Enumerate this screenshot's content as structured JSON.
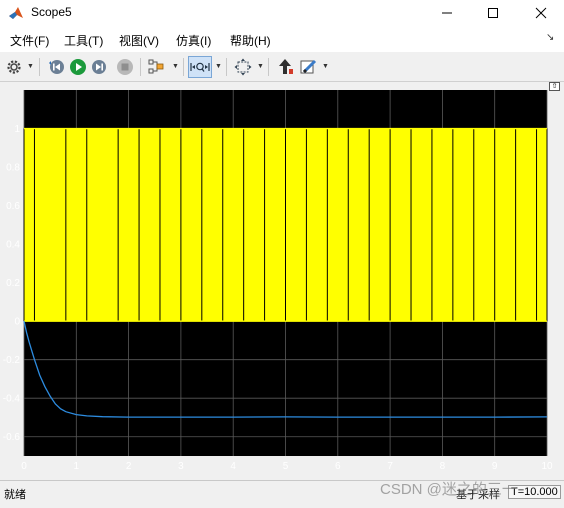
{
  "window": {
    "title": "Scope5"
  },
  "menu": {
    "items": [
      "文件(F)",
      "工具(T)",
      "视图(V)",
      "仿真(I)",
      "帮助(H)"
    ]
  },
  "toolbar": {
    "icons": [
      "gear-icon",
      "step-back-icon",
      "run-icon",
      "stop-icon",
      "triggers-icon",
      "zoom-x-icon",
      "autoscale-icon",
      "write-icon",
      "highlight-icon"
    ]
  },
  "status": {
    "left": "就绪",
    "middle": "基于采样",
    "time": "T=10.000"
  },
  "watermark": "CSDN @迷之的三一",
  "colors": {
    "plot_background": "#000000",
    "signal_1": "#ffff00",
    "signal_2": "#2d8ce0",
    "grid": "#5a5a5a",
    "axis_text": "#ffffff"
  },
  "chart_data": {
    "type": "line",
    "xlim": [
      0,
      10
    ],
    "ylim": [
      -0.7,
      1.2
    ],
    "xticks": [
      "0",
      "1",
      "2",
      "3",
      "4",
      "5",
      "6",
      "7",
      "8",
      "9",
      "10"
    ],
    "yticks": [
      "1",
      "0.8",
      "0.6",
      "0.4",
      "0.2",
      "0",
      "-0.2",
      "-0.4",
      "-0.6"
    ],
    "grid": true,
    "series": [
      {
        "color": "#ffff00",
        "kind": "square-wave",
        "low": 0,
        "high": 1,
        "edges": [
          0.0,
          0.2,
          0.8,
          1.2,
          1.8,
          2.2,
          2.6,
          3.0,
          3.4,
          3.8,
          4.2,
          4.6,
          5.0,
          5.4,
          5.8,
          6.2,
          6.6,
          7.0,
          7.4,
          7.8,
          8.2,
          8.6,
          9.0,
          9.4,
          9.8,
          10.0
        ]
      },
      {
        "color": "#2d8ce0",
        "kind": "line",
        "x": [
          0,
          0.05,
          0.1,
          0.2,
          0.3,
          0.4,
          0.5,
          0.6,
          0.7,
          0.8,
          1.0,
          1.2,
          1.5,
          2,
          3,
          4,
          5,
          6,
          7,
          8,
          9,
          10
        ],
        "y": [
          0,
          -0.06,
          -0.11,
          -0.2,
          -0.28,
          -0.34,
          -0.39,
          -0.43,
          -0.455,
          -0.47,
          -0.485,
          -0.492,
          -0.496,
          -0.498,
          -0.498,
          -0.498,
          -0.497,
          -0.498,
          -0.498,
          -0.498,
          -0.498,
          -0.497
        ]
      }
    ]
  }
}
